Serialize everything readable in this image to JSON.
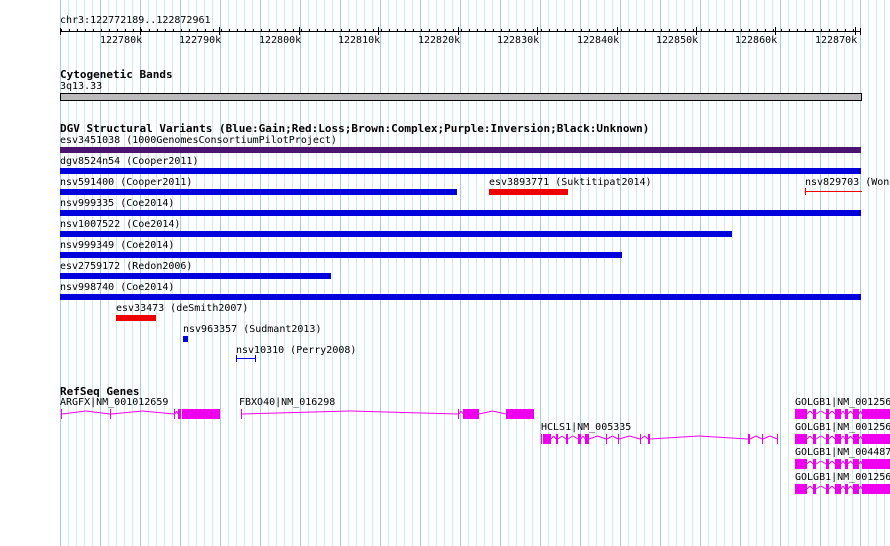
{
  "position": {
    "label": "chr3:122772189..122872961"
  },
  "ruler": {
    "ticks": [
      "122780k",
      "122790k",
      "122800k",
      "122810k",
      "122820k",
      "122830k",
      "122840k",
      "122850k",
      "122860k",
      "122870k"
    ]
  },
  "cytogenetic": {
    "title": "Cytogenetic Bands",
    "band": "3q13.33"
  },
  "dgv": {
    "title": "DGV Structural Variants (Blue:Gain;Red:Loss;Brown:Complex;Purple:Inversion;Black:Unknown)",
    "colors": {
      "gain": "#0000dd",
      "loss": "#ee0000",
      "inversion": "#4b1470"
    },
    "labels": {
      "esv3451038": "esv3451038 (1000GenomesConsortiumPilotProject)",
      "dgv8524n54": "dgv8524n54 (Cooper2011)",
      "nsv591400": "nsv591400 (Cooper2011)",
      "esv3893771": "esv3893771 (Suktitipat2014)",
      "nsv829703": "nsv829703 (Wong",
      "nsv999335": "nsv999335 (Coe2014)",
      "nsv1007522": "nsv1007522 (Coe2014)",
      "nsv999349": "nsv999349 (Coe2014)",
      "esv2759172": "esv2759172 (Redon2006)",
      "nsv998740": "nsv998740 (Coe2014)",
      "esv33473": "esv33473 (deSmith2007)",
      "nsv963357": "nsv963357 (Sudmant2013)",
      "nsv10310": "nsv10310 (Perry2008)"
    }
  },
  "refseq": {
    "title": "RefSeq Genes",
    "color": "#ee00ee",
    "labels": {
      "argfx": "ARGFX|NM_001012659",
      "fbxo40": "FBXO40|NM_016298",
      "hcls1": "HCLS1|NM_005335",
      "golgb1_a": "GOLGB1|NM_001256",
      "golgb1_b": "GOLGB1|NM_001256",
      "golgb1_c": "GOLGB1|NM_004487",
      "golgb1_d": "GOLGB1|NM_001256"
    }
  }
}
